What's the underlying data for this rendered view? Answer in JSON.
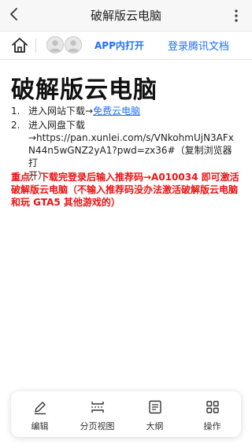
{
  "navbar": {
    "title": "破解版云电脑",
    "back_icon": "chevron-left-icon",
    "more_icon": "more-vertical-icon"
  },
  "docbar": {
    "home_icon": "home-icon",
    "avatars": [
      "user-avatar-icon",
      "user-avatar-icon"
    ],
    "app_open_label": "APP内打开",
    "login_label": "登录腾讯文档",
    "link_color": "#1e6fff"
  },
  "document": {
    "title": "破解版云电脑",
    "items": [
      {
        "number": "1.",
        "text": "进入网站下载→",
        "link_text": "免费云电脑"
      },
      {
        "number": "2.",
        "line1": "进入网盘下载",
        "line2": "→https://pan.xunlei.com/s/VNkohmUjN3AFx",
        "line3": "N44n5wGNZ2yA1?pwd=zx36#（复制浏览器打",
        "line4": "开）"
      }
    ],
    "notice": "重点：下载完登录后输入推荐码→A010034 即可激活破解版云电脑（不输入推荐码没办法激活破解版云电脑和玩 GTA5 其他游戏的）",
    "notice_color": "#ee1111"
  },
  "toolbar": {
    "items": [
      {
        "label": "编辑",
        "icon": "pencil-icon"
      },
      {
        "label": "分页视图",
        "icon": "page-view-icon"
      },
      {
        "label": "大纲",
        "icon": "outline-icon"
      },
      {
        "label": "操作",
        "icon": "grid-icon"
      }
    ]
  }
}
